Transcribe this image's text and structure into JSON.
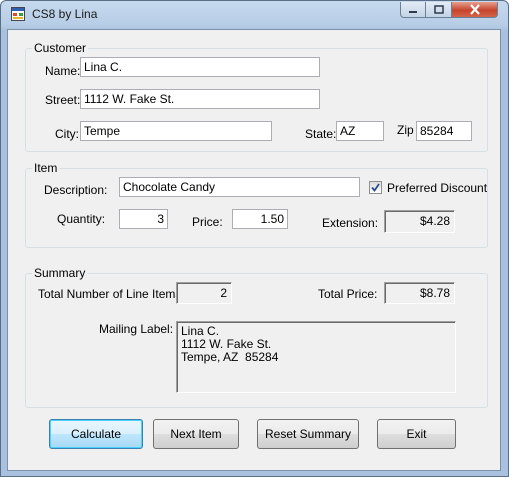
{
  "window": {
    "title": "CS8 by Lina"
  },
  "customer": {
    "legend": "Customer",
    "name_label": "Name:",
    "name_value": "Lina C.",
    "street_label": "Street:",
    "street_value": "1112 W. Fake St.",
    "city_label": "City:",
    "city_value": "Tempe",
    "state_label": "State:",
    "state_value": "AZ",
    "zip_label": "Zip",
    "zip_value": "85284"
  },
  "item": {
    "legend": "Item",
    "description_label": "Description:",
    "description_value": "Chocolate Candy",
    "preferred_label": "Preferred Discount",
    "preferred_checked": true,
    "quantity_label": "Quantity:",
    "quantity_value": "3",
    "price_label": "Price:",
    "price_value": "1.50",
    "extension_label": "Extension:",
    "extension_value": "$4.28"
  },
  "summary": {
    "legend": "Summary",
    "total_items_label": "Total Number of Line Items:",
    "total_items_value": "2",
    "total_price_label": "Total Price:",
    "total_price_value": "$8.78",
    "mailing_label": "Mailing Label:",
    "mailing_value": "Lina C.\n1112 W. Fake St.\nTempe, AZ  85284"
  },
  "buttons": {
    "calculate": "Calculate",
    "next_item": "Next Item",
    "reset_summary": "Reset Summary",
    "exit": "Exit"
  },
  "icons": {
    "app": "app-window-icon",
    "minimize": "minimize-icon",
    "maximize": "maximize-icon",
    "close": "close-icon",
    "check": "checkmark-icon"
  },
  "colors": {
    "title_bar": "#b7cde6",
    "close_button": "#c6442c",
    "form_background": "#f0f0f0",
    "default_button_border": "#3c7fb1"
  }
}
